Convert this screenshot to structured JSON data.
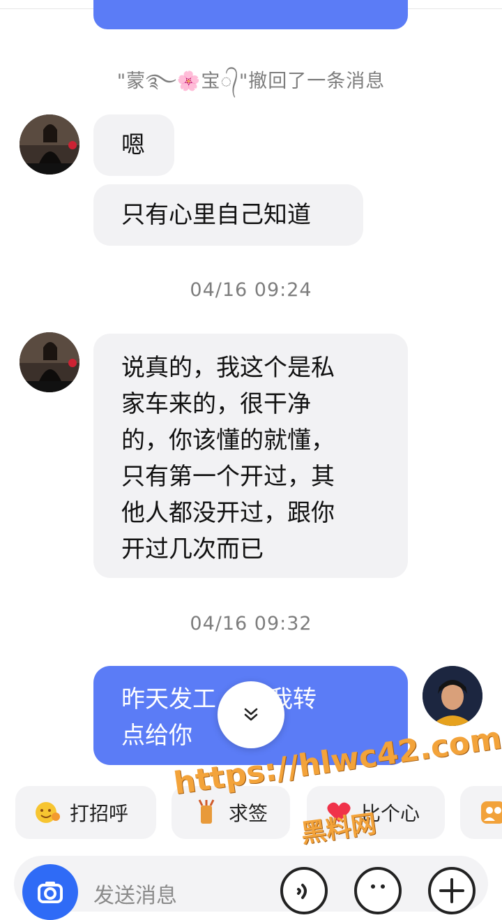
{
  "recall_notice": "\"蒙࿐🌸宝᭄\"撤回了一条消息",
  "messages": [
    {
      "text": "嗯"
    },
    {
      "text": "只有心里自己知道"
    },
    {
      "timestamp": "04/16 09:24"
    },
    {
      "lines": [
        "说真的，我这个是私",
        "家车来的，很干净",
        "的，你该懂的就懂，",
        "只有第一个开过，其",
        "他人都没开过，跟你",
        "开过几次而已"
      ]
    },
    {
      "timestamp": "04/16 09:32"
    },
    {
      "lines": [
        "昨天发工",
        "，我转",
        "点给你"
      ]
    }
  ],
  "quick_actions": [
    {
      "label": "打招呼",
      "icon": "smile-wave-icon"
    },
    {
      "label": "求签",
      "icon": "fortune-icon"
    },
    {
      "label": "比个心",
      "icon": "heart-icon"
    },
    {
      "label": "",
      "icon": "group-icon"
    }
  ],
  "input": {
    "placeholder": "发送消息"
  },
  "watermark": {
    "url": "https://hlwc42.com",
    "name": "黑料网"
  },
  "colors": {
    "accent": "#5b7cf6",
    "incoming_bubble": "#f2f2f4",
    "watermark": "#f3a33a"
  }
}
